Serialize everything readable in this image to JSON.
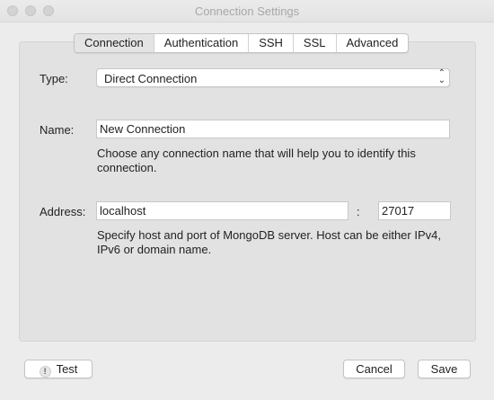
{
  "window": {
    "title": "Connection Settings"
  },
  "tabs": [
    {
      "label": "Connection",
      "active": true
    },
    {
      "label": "Authentication",
      "active": false
    },
    {
      "label": "SSH",
      "active": false
    },
    {
      "label": "SSL",
      "active": false
    },
    {
      "label": "Advanced",
      "active": false
    }
  ],
  "form": {
    "type_label": "Type:",
    "type_value": "Direct Connection",
    "name_label": "Name:",
    "name_value": "New Connection",
    "name_help": "Choose any connection name that will help you to identify this connection.",
    "address_label": "Address:",
    "host_value": "localhost",
    "port_separator": ":",
    "port_value": "27017",
    "address_help": "Specify host and port of MongoDB server. Host can be either IPv4, IPv6 or domain name."
  },
  "buttons": {
    "test_label": "Test",
    "cancel_label": "Cancel",
    "save_label": "Save"
  },
  "icons": {
    "test_icon": "!",
    "select_arrows": "up-down-chevron-icon"
  }
}
